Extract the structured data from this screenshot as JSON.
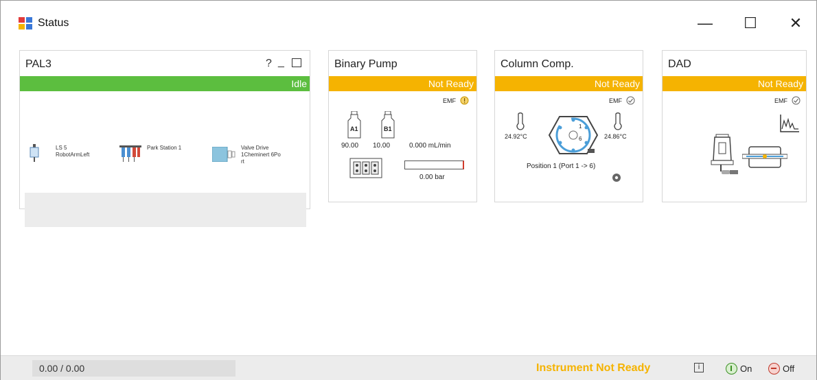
{
  "window": {
    "title": "Status",
    "minimize_glyph": "—",
    "maximize_glyph": "☐",
    "close_glyph": "✕"
  },
  "modules": {
    "pal3": {
      "title": "PAL3",
      "help": "?",
      "status": "Idle",
      "status_color": "#5cbe3f",
      "components": [
        {
          "label": "LS 5\nRobotArmLeft"
        },
        {
          "label": "Park Station 1"
        },
        {
          "label": "Valve Drive\n1Cheminert 6Po\nrt"
        }
      ]
    },
    "binary_pump": {
      "title": "Binary Pump",
      "status": "Not Ready",
      "status_color": "#f5b301",
      "emf": "EMF",
      "bottle_a": "A1",
      "bottle_b": "B1",
      "percent_a": "90.00",
      "percent_b": "10.00",
      "flow": "0.000 mL/min",
      "pressure": "0.00 bar",
      "pressure_fraction": 0.0
    },
    "column_comp": {
      "title": "Column Comp.",
      "status": "Not Ready",
      "status_color": "#f5b301",
      "emf": "EMF",
      "temp_left": "24.92°C",
      "temp_right": "24.86°C",
      "port_top": "1",
      "port_bottom": "6",
      "position": "Position 1 (Port 1 -> 6)"
    },
    "dad": {
      "title": "DAD",
      "status": "Not Ready",
      "status_color": "#f5b301",
      "emf": "EMF"
    }
  },
  "footer": {
    "counter": "0.00 / 0.00",
    "instrument_status": "Instrument Not Ready",
    "instrument_status_color": "#f5b301",
    "info": "i",
    "on_label": "On",
    "off_label": "Off"
  }
}
